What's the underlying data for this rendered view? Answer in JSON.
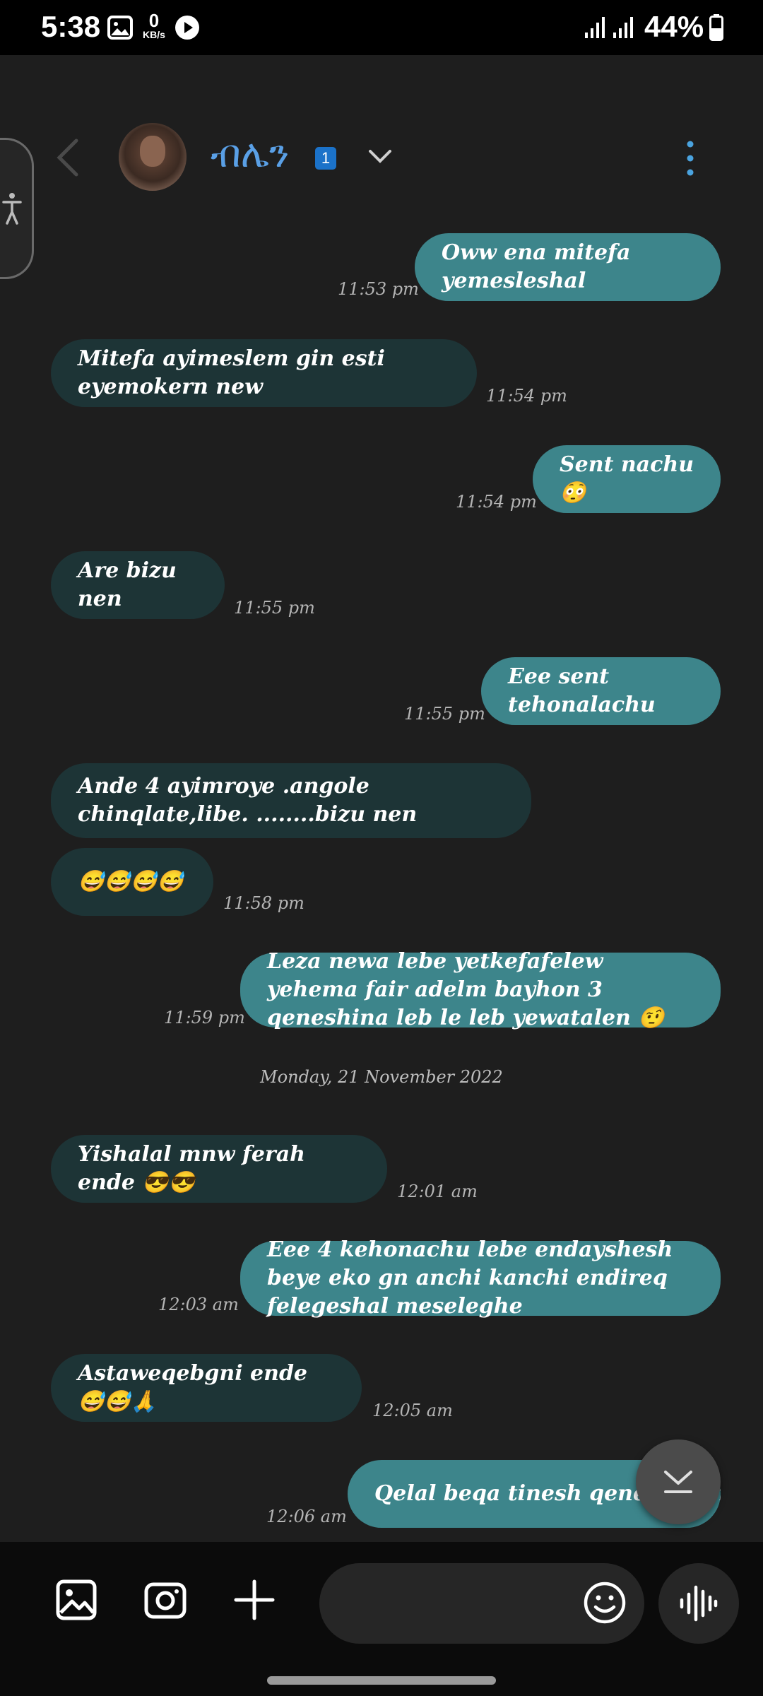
{
  "status_bar": {
    "time": "5:38",
    "net_speed_value": "0",
    "net_speed_unit": "KB/s",
    "battery_text": "44%"
  },
  "header": {
    "contact_name": "ብሌን",
    "badge": "1"
  },
  "messages": [
    {
      "dir": "out",
      "text": "Oww ena mitefa yemesleshal",
      "time": "11:53 pm"
    },
    {
      "dir": "in",
      "text": "Mitefa ayimeslem gin esti eyemokern new",
      "time": "11:54 pm"
    },
    {
      "dir": "out",
      "text": "Sent nachu 😳",
      "time": "11:54 pm"
    },
    {
      "dir": "in",
      "text": "Are bizu nen",
      "time": "11:55 pm"
    },
    {
      "dir": "out",
      "text": "Eee sent tehonalachu",
      "time": "11:55 pm"
    },
    {
      "dir": "in",
      "text": "Ande 4 ayimroye .angole chinqlate,libe. ........bizu nen",
      "time": ""
    },
    {
      "dir": "in",
      "text": "😅😅😅😅",
      "time": "11:58 pm"
    },
    {
      "dir": "out",
      "text": "Leza newa lebe yetkefafelew yehema fair adelm bayhon 3 qeneshina leb le leb yewatalen 🤨",
      "time": "11:59 pm"
    },
    {
      "dir": "in",
      "text": "Yishalal mnw ferah ende 😎😎",
      "time": "12:01 am"
    },
    {
      "dir": "out",
      "text": "Eee 4 kehonachu lebe endayshesh beye eko gn anchi kanchi endireq felegeshal meseleghe",
      "time": "12:03 am"
    },
    {
      "dir": "in",
      "text": "Astaweqebgni ende 😅😅🙏",
      "time": "12:05 am"
    },
    {
      "dir": "out",
      "text": "Qelal beqa tinesh qene nw tar",
      "time": "12:06 am"
    }
  ],
  "date_separator": "Monday, 21 November 2022",
  "composer": {
    "placeholder": ""
  },
  "icons": {
    "gallery": "gallery-icon",
    "camera": "camera-icon",
    "plus": "plus-icon",
    "emoji": "emoji-icon",
    "voice": "voice-icon",
    "accessibility": "accessibility-icon"
  },
  "colors": {
    "outgoing_bubble": "#3d858b",
    "incoming_bubble": "#1d3436",
    "accent_name": "#5aa0e6",
    "background": "#1e1e1e"
  }
}
